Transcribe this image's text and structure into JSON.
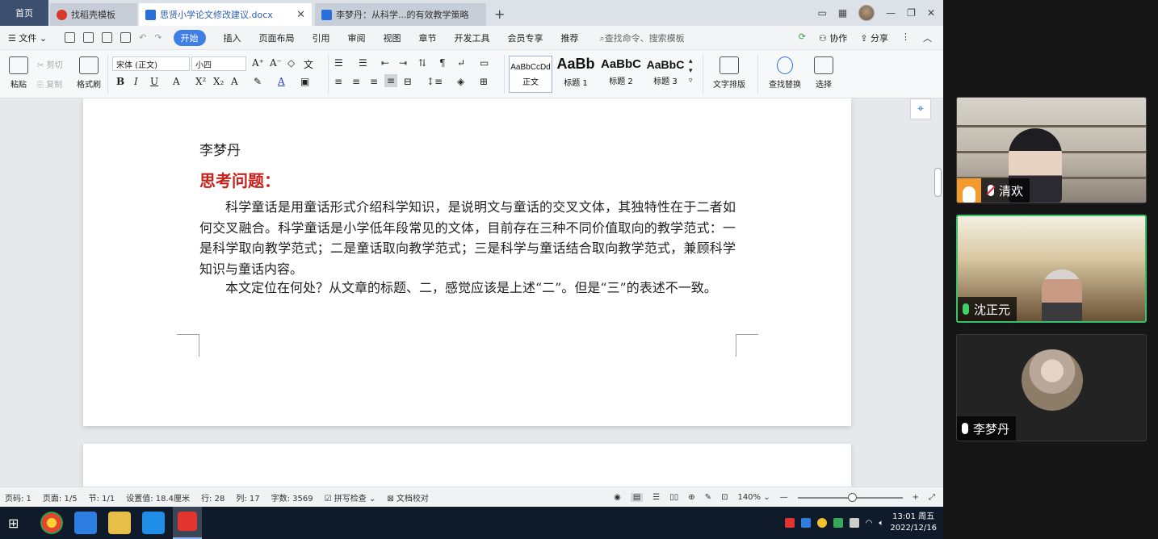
{
  "tabs": {
    "home": "首页",
    "tab1": "找稻壳模板",
    "tab2": "思贤小学论文修改建议.docx",
    "tab3": "李梦丹：从科学...的有效教学策略"
  },
  "menu": {
    "file": "文件",
    "items": [
      "开始",
      "插入",
      "页面布局",
      "引用",
      "审阅",
      "视图",
      "章节",
      "开发工具",
      "会员专享",
      "推荐"
    ],
    "search": "查找命令、搜索模板",
    "collab": "协作",
    "share": "分享"
  },
  "ribbon": {
    "paste": "粘贴",
    "cut": "剪切",
    "copy": "复制",
    "format_painter": "格式刷",
    "font_name": "宋体 (正文)",
    "font_size": "小四",
    "styles": [
      {
        "preview": "AaBbCcDd",
        "label": "正文"
      },
      {
        "preview": "AaBb",
        "label": "标题 1"
      },
      {
        "preview": "AaBbC",
        "label": "标题 2"
      },
      {
        "preview": "AaBbC",
        "label": "标题 3"
      }
    ],
    "text_layout": "文字排版",
    "find_replace": "查找替换",
    "select": "选择"
  },
  "document": {
    "author": "李梦丹",
    "heading": "思考问题：",
    "para1": "科学童话是用童话形式介绍科学知识，是说明文与童话的交叉文体，其独特性在于二者如何交叉融合。科学童话是小学低年段常见的文体，目前存在三种不同价值取向的教学范式：一是科学取向教学范式；二是童话取向教学范式；三是科学与童话结合取向教学范式，兼顾科学知识与童话内容。",
    "para2": "本文定位在何处？从文章的标题、二，感觉应该是上述“二”。但是“三”的表述不一致。"
  },
  "status": {
    "page_num": "页码: 1",
    "pages": "页面: 1/5",
    "section": "节: 1/1",
    "position": "设置值: 18.4厘米",
    "row": "行: 28",
    "col": "列: 17",
    "words": "字数: 3569",
    "spell": "拼写检查",
    "proof": "文档校对",
    "zoom": "140%",
    "zoom_fraction": 0.52
  },
  "participants": [
    {
      "name": "清欢"
    },
    {
      "name": "沈正元"
    },
    {
      "name": "李梦丹"
    }
  ],
  "taskbar": {
    "time": "13:01 周五",
    "date": "2022/12/16"
  }
}
